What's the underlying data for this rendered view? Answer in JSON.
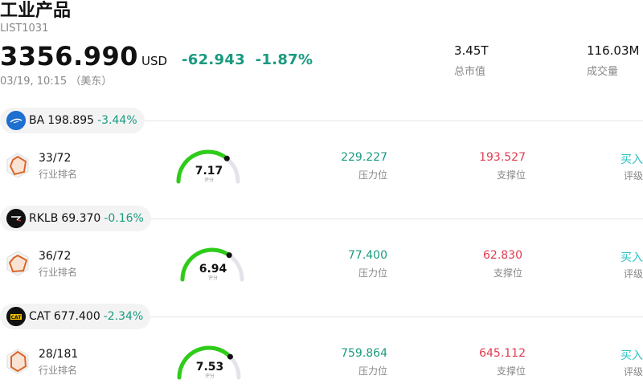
{
  "header": {
    "title": "工业产品",
    "code": "LIST1031",
    "price": "3356.990",
    "currency": "USD",
    "change": "-62.943",
    "change_pct": "-1.87%",
    "time": "03/19, 10:15 （美东）",
    "market_cap_value": "3.45T",
    "market_cap_label": "总市值",
    "volume_value": "116.03M",
    "volume_label": "成交量"
  },
  "colors": {
    "up": "#e03c50",
    "down": "#1a9a80",
    "rating": "#2cc4c4",
    "gauge": "#2ecc19"
  },
  "stocks": [
    {
      "ticker": "BA",
      "price": "198.895",
      "change": "-3.44%",
      "logo": "boeing-logo",
      "rank": "33/72",
      "rank_label": "行业排名",
      "score": "7.17",
      "score_label": "评分",
      "score_value": 7.17,
      "resistance": "229.227",
      "resistance_label": "压力位",
      "support": "193.527",
      "support_label": "支撑位",
      "rating": "买入",
      "rating_label": "评级"
    },
    {
      "ticker": "RKLB",
      "price": "69.370",
      "change": "-0.16%",
      "logo": "rocketlab-logo",
      "rank": "36/72",
      "rank_label": "行业排名",
      "score": "6.94",
      "score_label": "评分",
      "score_value": 6.94,
      "resistance": "77.400",
      "resistance_label": "压力位",
      "support": "62.830",
      "support_label": "支撑位",
      "rating": "买入",
      "rating_label": "评级"
    },
    {
      "ticker": "CAT",
      "price": "677.400",
      "change": "-2.34%",
      "logo": "caterpillar-logo",
      "rank": "28/181",
      "rank_label": "行业排名",
      "score": "7.53",
      "score_label": "评分",
      "score_value": 7.53,
      "resistance": "759.864",
      "resistance_label": "压力位",
      "support": "645.112",
      "support_label": "支撑位",
      "rating": "买入",
      "rating_label": "评级"
    }
  ]
}
